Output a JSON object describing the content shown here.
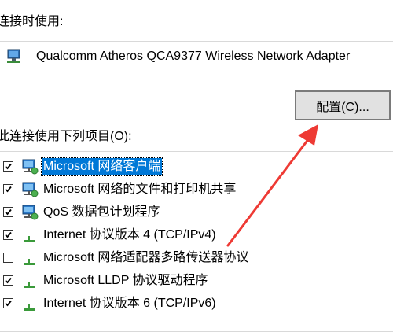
{
  "connect_using_label": "连接时使用:",
  "adapter": {
    "name": "Qualcomm Atheros QCA9377 Wireless Network Adapter",
    "icon": "network-adapter-icon"
  },
  "configure_button": "配置(C)...",
  "items_label": "此连接使用下列项目(O):",
  "items": [
    {
      "label": "Microsoft 网络客户端",
      "checked": true,
      "selected": true,
      "icon": "network-client-icon"
    },
    {
      "label": "Microsoft 网络的文件和打印机共享",
      "checked": true,
      "selected": false,
      "icon": "network-client-icon"
    },
    {
      "label": "QoS 数据包计划程序",
      "checked": true,
      "selected": false,
      "icon": "network-client-icon"
    },
    {
      "label": "Internet 协议版本 4 (TCP/IPv4)",
      "checked": true,
      "selected": false,
      "icon": "protocol-icon"
    },
    {
      "label": "Microsoft 网络适配器多路传送器协议",
      "checked": false,
      "selected": false,
      "icon": "protocol-icon"
    },
    {
      "label": "Microsoft LLDP 协议驱动程序",
      "checked": true,
      "selected": false,
      "icon": "protocol-icon"
    },
    {
      "label": "Internet 协议版本 6 (TCP/IPv6)",
      "checked": true,
      "selected": false,
      "icon": "protocol-icon"
    }
  ],
  "colors": {
    "selection": "#0078d7",
    "annotation_arrow": "#ee3a34"
  }
}
